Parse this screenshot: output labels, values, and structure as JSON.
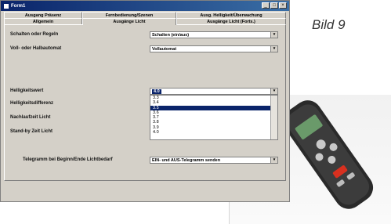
{
  "caption": "Bild 9",
  "window": {
    "title": "Form1",
    "buttons": {
      "minimize": "_",
      "maximize": "□",
      "close": "×"
    }
  },
  "tabs_top": [
    {
      "label": "Ausgang Präsenz"
    },
    {
      "label": "Fernbedienung/Szenen"
    },
    {
      "label": "Ausg. Helligkeit/Überwachung"
    }
  ],
  "tabs_bottom": [
    {
      "label": "Allgemein"
    },
    {
      "label": "Ausgänge Licht"
    },
    {
      "label": "Ausgänge Licht (Forts.)"
    }
  ],
  "fields": {
    "schalten_label": "Schalten oder Regeln",
    "schalten_value": "Schalten (ein/aus)",
    "vollauto_label": "Voll- oder Halbautomat",
    "vollauto_value": "Vollautomat",
    "helligkeit_label": "Helligkeitswert",
    "helligkeit_value": "4.0",
    "diff_label": "Helligkeitsdifferenz",
    "nachlauf_label": "Nachlaufzeit Licht",
    "standby_label": "Stand-by Zeit Licht",
    "telegramm_label": "Telegramm bei Beginn/Ende Lichtbedarf",
    "telegramm_value": "EIN- und AUS-Telegramm senden"
  },
  "dropdown_options": [
    "3.3",
    "3.4",
    "3.5",
    "3.6",
    "3.7",
    "3.8",
    "3.9",
    "4.0"
  ],
  "dropdown_selected": "3.5"
}
